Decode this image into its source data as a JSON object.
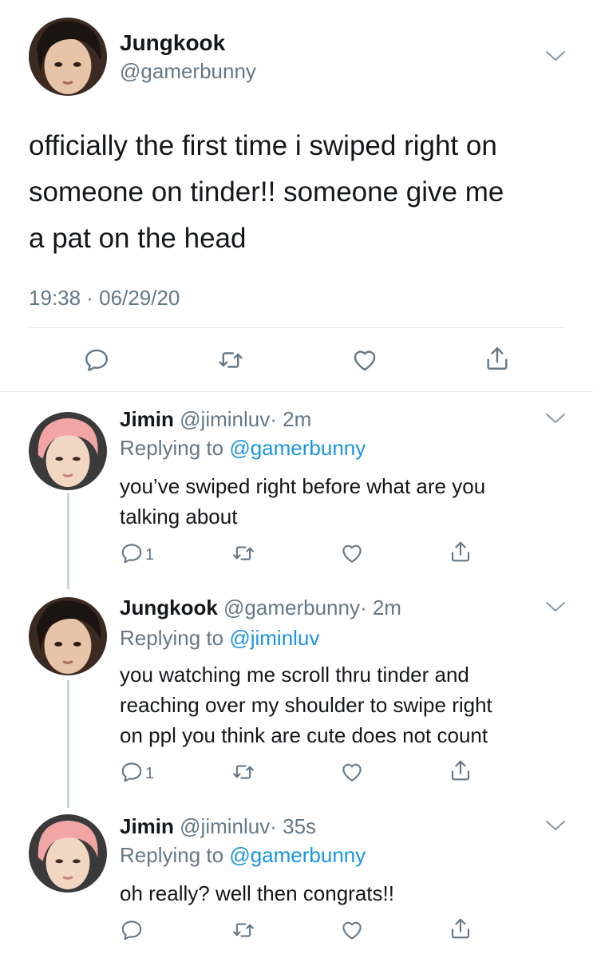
{
  "main_tweet": {
    "name": "Jungkook",
    "handle": "@gamerbunny",
    "text_lines": [
      "officially the first time i swiped right on",
      "someone on tinder!! someone give me",
      "a pat on the head"
    ],
    "timestamp": "19:38 · 06/29/20",
    "avatar_icon": "avatar-jungkook"
  },
  "replies": [
    {
      "name": "Jimin",
      "handle": "@jiminluv",
      "time": "· 2m",
      "replying_prefix": "Replying to",
      "replying_to": "@gamerbunny",
      "text_lines": [
        "you’ve swiped right before what are you",
        "talking about"
      ],
      "reply_count": "1",
      "avatar_icon": "avatar-jimin"
    },
    {
      "name": "Jungkook",
      "handle": "@gamerbunny",
      "time": "· 2m",
      "replying_prefix": "Replying to",
      "replying_to": "@jiminluv",
      "text_lines": [
        "you watching me scroll thru tinder and",
        "reaching over my shoulder to swipe right",
        "on ppl you think are cute does not count"
      ],
      "reply_count": "1",
      "avatar_icon": "avatar-jungkook"
    },
    {
      "name": "Jimin",
      "handle": "@jiminluv",
      "time": "· 35s",
      "replying_prefix": "Replying to",
      "replying_to": "@gamerbunny",
      "text_lines": [
        "oh really? well then congrats!!"
      ],
      "reply_count": "",
      "avatar_icon": "avatar-jimin"
    }
  ],
  "colors": {
    "link": "#1b95e0",
    "secondary": "#657786",
    "divider": "#e6ecf0",
    "thread_line": "#ccd6dd"
  }
}
